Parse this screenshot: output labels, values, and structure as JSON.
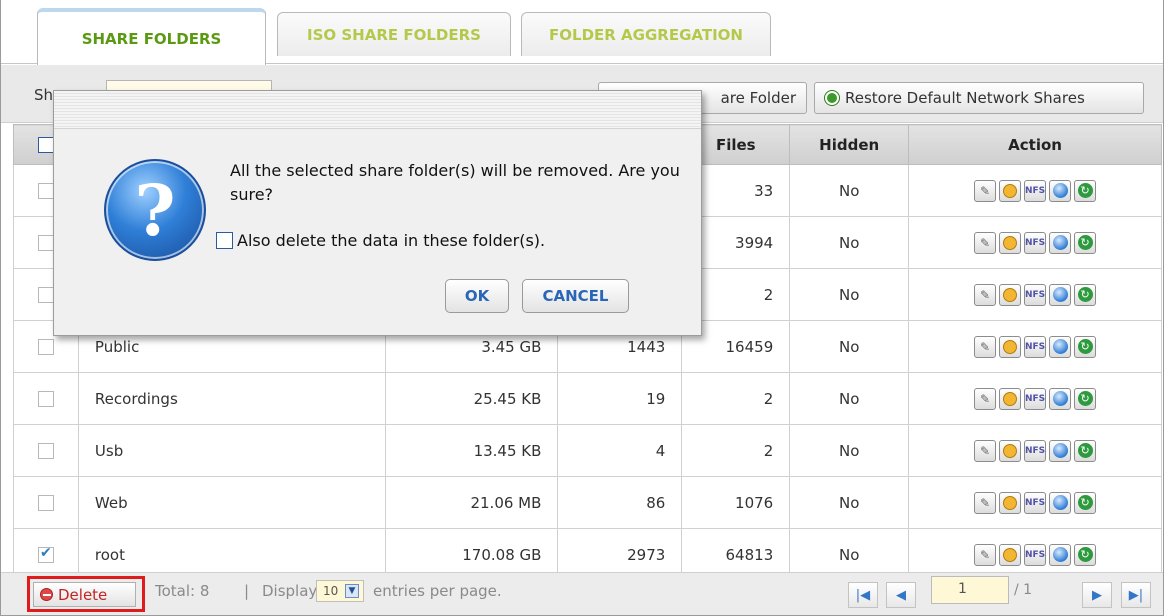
{
  "tabs": [
    "SHARE FOLDERS",
    "ISO SHARE FOLDERS",
    "FOLDER AGGREGATION"
  ],
  "toolbar": {
    "label": "Sh",
    "add_label": "are Folder",
    "restore_label": "Restore Default Network Shares"
  },
  "table": {
    "headers": [
      "",
      "",
      "",
      "",
      "Files",
      "Hidden",
      "Action"
    ],
    "rows": [
      {
        "name": "",
        "size": "",
        "folders": "",
        "files": "33",
        "hidden": "No",
        "checked": false
      },
      {
        "name": "",
        "size": "",
        "folders": "",
        "files": "3994",
        "hidden": "No",
        "checked": false
      },
      {
        "name": "",
        "size": "",
        "folders": "",
        "files": "2",
        "hidden": "No",
        "checked": false
      },
      {
        "name": "Public",
        "size": "3.45 GB",
        "folders": "1443",
        "files": "16459",
        "hidden": "No",
        "checked": false
      },
      {
        "name": "Recordings",
        "size": "25.45 KB",
        "folders": "19",
        "files": "2",
        "hidden": "No",
        "checked": false
      },
      {
        "name": "Usb",
        "size": "13.45 KB",
        "folders": "4",
        "files": "2",
        "hidden": "No",
        "checked": false
      },
      {
        "name": "Web",
        "size": "21.06 MB",
        "folders": "86",
        "files": "1076",
        "hidden": "No",
        "checked": false
      },
      {
        "name": "root",
        "size": "170.08 GB",
        "folders": "2973",
        "files": "64813",
        "hidden": "No",
        "checked": true
      }
    ],
    "action_icons": [
      "edit-icon",
      "permission-icon",
      "nfs-icon",
      "globe-icon",
      "refresh-icon"
    ]
  },
  "footer": {
    "delete_label": "Delete",
    "total": "Total: 8",
    "sep": "|",
    "display": "Display",
    "per_page_value": "10",
    "entries": "entries per page.",
    "page": "1",
    "page_total": "/ 1"
  },
  "dialog": {
    "message": "All the selected share folder(s) will be removed. Are you sure?",
    "option": "Also delete the data in these folder(s).",
    "ok": "OK",
    "cancel": "CANCEL"
  },
  "colors": {
    "accent_green": "#5a9a12",
    "highlight_red": "#e01b1b",
    "link_blue": "#2a66b8"
  }
}
